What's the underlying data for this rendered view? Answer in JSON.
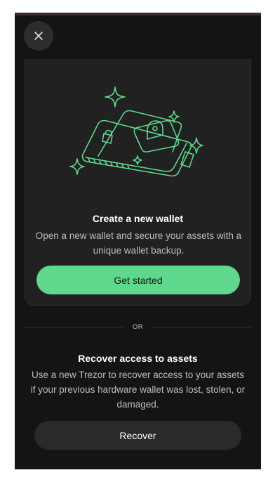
{
  "header": {
    "close_icon": "close-icon"
  },
  "create_card": {
    "illustration_icon": "wallet-illustration",
    "title": "Create a new wallet",
    "description": "Open a new wallet and secure your assets with a unique wallet backup.",
    "button_label": "Get started"
  },
  "divider": {
    "label": "OR"
  },
  "recover_section": {
    "title": "Recover access to assets",
    "description": "Use a new Trezor to recover access to your assets if your previous hardware wallet was lost, stolen, or damaged.",
    "button_label": "Recover"
  },
  "colors": {
    "background": "#141414",
    "card": "#212121",
    "accent": "#5fd88d",
    "secondary_button": "#2a2a2a",
    "muted_text": "#bdbdbd"
  }
}
